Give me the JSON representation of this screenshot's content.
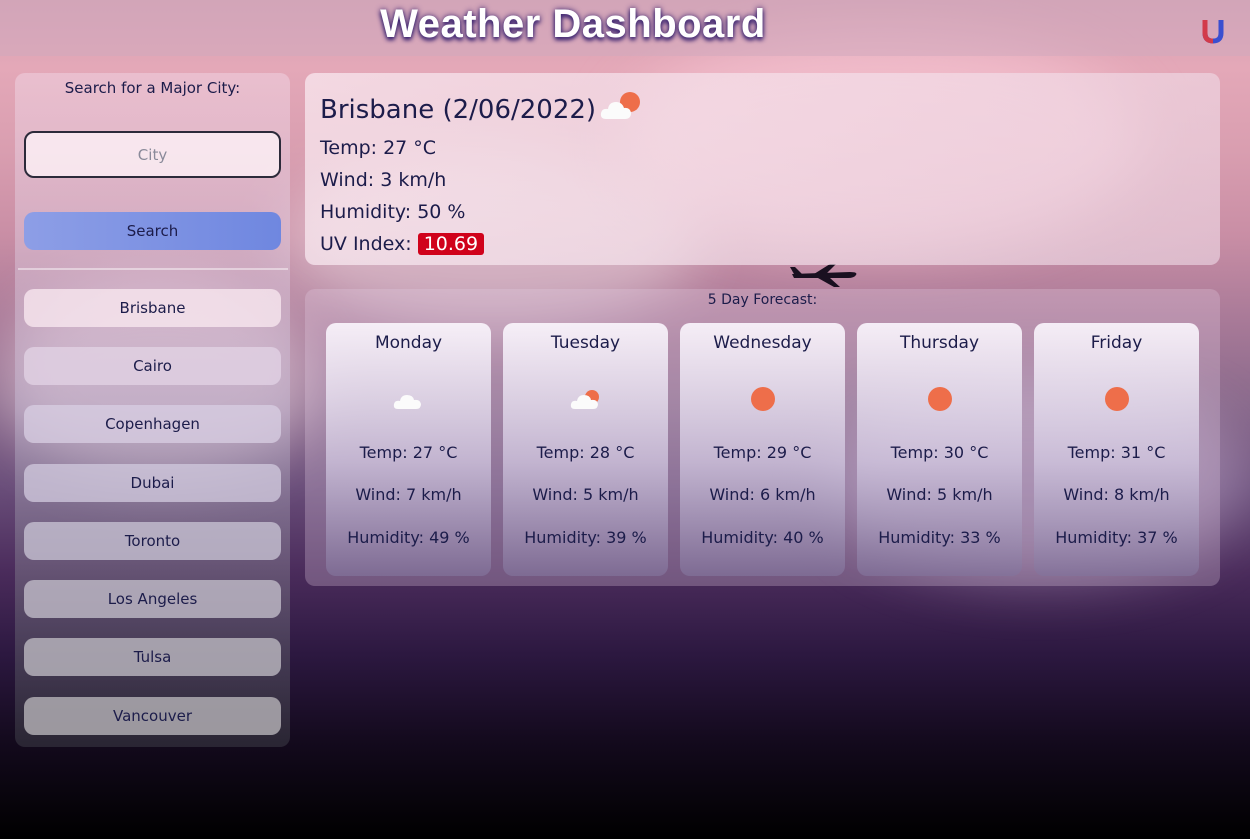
{
  "header": {
    "title": "Weather Dashboard",
    "logo_icon": "magnet-icon"
  },
  "sidebar": {
    "label": "Search for a Major City:",
    "search_placeholder": "City",
    "search_value": "",
    "search_button": "Search",
    "cities": [
      "Brisbane",
      "Cairo",
      "Copenhagen",
      "Dubai",
      "Toronto",
      "Los Angeles",
      "Tulsa",
      "Vancouver"
    ]
  },
  "current": {
    "city_date": "Brisbane (2/06/2022)",
    "icon": "partly-cloudy-icon",
    "temp": "Temp: 27 °C",
    "wind": "Wind: 3 km/h",
    "humidity": "Humidity: 50 %",
    "uv_label": "UV Index:",
    "uv_value": "10.69",
    "uv_color": "#d0021b"
  },
  "forecast": {
    "label": "5 Day Forecast:",
    "days": [
      {
        "day": "Monday",
        "icon": "cloud-icon",
        "temp": "Temp: 27 °C",
        "wind": "Wind: 7 km/h",
        "humidity": "Humidity: 49 %"
      },
      {
        "day": "Tuesday",
        "icon": "partly-cloudy-icon",
        "temp": "Temp: 28 °C",
        "wind": "Wind: 5 km/h",
        "humidity": "Humidity: 39 %"
      },
      {
        "day": "Wednesday",
        "icon": "sun-icon",
        "temp": "Temp: 29 °C",
        "wind": "Wind: 6 km/h",
        "humidity": "Humidity: 40 %"
      },
      {
        "day": "Thursday",
        "icon": "sun-icon",
        "temp": "Temp: 30 °C",
        "wind": "Wind: 5 km/h",
        "humidity": "Humidity: 33 %"
      },
      {
        "day": "Friday",
        "icon": "sun-icon",
        "temp": "Temp: 31 °C",
        "wind": "Wind: 8 km/h",
        "humidity": "Humidity: 37 %"
      }
    ]
  },
  "colors": {
    "sun": "#ee6e4a",
    "cloud": "#ffffff",
    "accent_button": "#7b91e3"
  }
}
